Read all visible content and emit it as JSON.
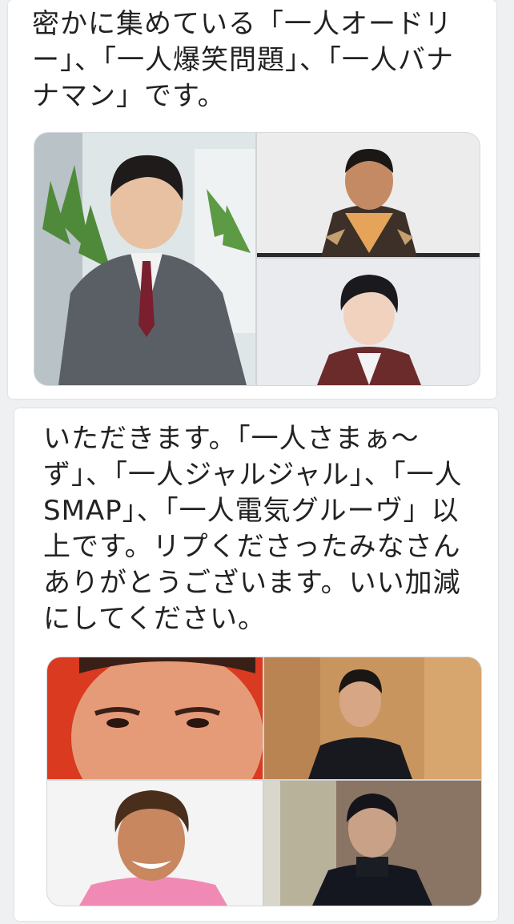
{
  "post_top": {
    "text": "密かに集めている「一人オードリー」、「一人爆笑問題」、「一人バナナマン」です。"
  },
  "post_bottom": {
    "text": "いただきます。「一人さまぁ〜ず」、「一人ジャルジャル」、「一人SMAP」、「一人電気グルーヴ」以上です。リプくださったみなさんありがとうございます。いい加減にしてください。"
  },
  "images": {
    "grid1": [
      "photo-man-in-suit",
      "photo-man-in-sweater",
      "photo-young-man"
    ],
    "grid2": [
      "photo-closeup-face-red",
      "photo-man-wood-wall",
      "photo-smiling-man-pink",
      "photo-man-black-turtleneck"
    ]
  },
  "colors": {
    "background": "#eef0f2",
    "card": "#ffffff",
    "text": "#222222"
  }
}
